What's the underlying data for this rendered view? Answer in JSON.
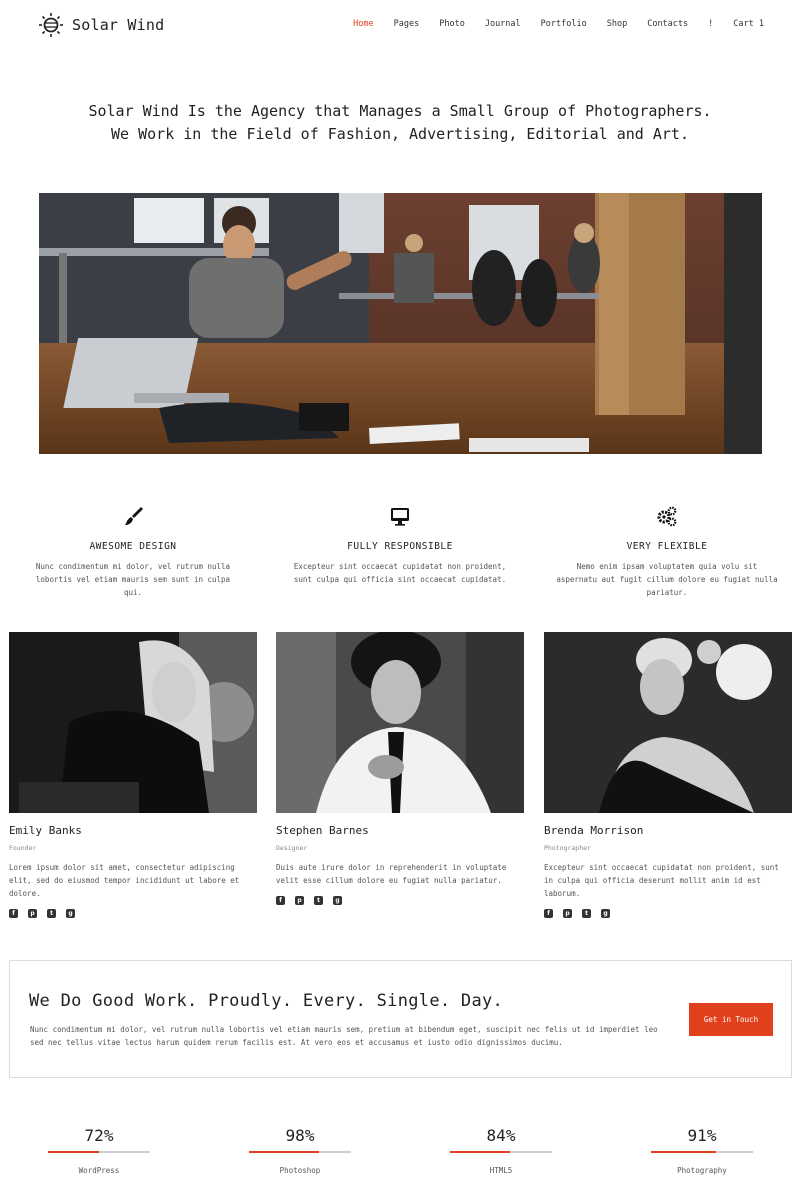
{
  "header": {
    "logo_text": "Solar Wind",
    "nav": [
      {
        "label": "Home",
        "active": true
      },
      {
        "label": "Pages"
      },
      {
        "label": "Photo"
      },
      {
        "label": "Journal"
      },
      {
        "label": "Portfolio"
      },
      {
        "label": "Shop"
      },
      {
        "label": "Contacts"
      },
      {
        "label": "!"
      },
      {
        "label": "Cart 1"
      }
    ]
  },
  "hero": {
    "line1": "Solar Wind Is the Agency that Manages a Small Group of Photographers.",
    "line2": "We Work in the Field of Fashion, Advertising, Editorial and Art."
  },
  "features": [
    {
      "icon": "paintbrush-icon",
      "title": "AWESOME DESIGN",
      "desc": "Nunc condimentum mi dolor, vel rutrum nulla lobortis vel etiam mauris sem sunt in culpa qui."
    },
    {
      "icon": "monitor-icon",
      "title": "FULLY RESPONSIBLE",
      "desc": "Excepteur sint occaecat cupidatat non proident, sunt culpa qui officia sint occaecat cupidatat."
    },
    {
      "icon": "gears-icon",
      "title": "VERY FLEXIBLE",
      "desc": "Nemo enim ipsam voluptatem quia volu sit aspernatu aut fugit cillum dolore eu fugiat nulla pariatur."
    }
  ],
  "team": [
    {
      "name": "Emily Banks",
      "role": "Founder",
      "bio": "Lorem ipsum dolor sit amet, consectetur adipiscing elit, sed do eiusmod tempor incididunt ut labore et dolore."
    },
    {
      "name": "Stephen Barnes",
      "role": "Designer",
      "bio": "Duis aute irure dolor in reprehenderit in voluptate velit esse cillum dolore eu fugiat nulla pariatur."
    },
    {
      "name": "Brenda Morrison",
      "role": "Photographer",
      "bio": "Excepteur sint occaecat cupidatat non proident, sunt in culpa qui officia deserunt mollit anim id est laborum."
    }
  ],
  "social_icons": [
    "facebook-icon",
    "pinterest-icon",
    "twitter-icon",
    "google-plus-icon"
  ],
  "cta": {
    "title": "We Do Good Work. Proudly. Every. Single. Day.",
    "desc": "Nunc condimentum mi dolor, vel rutrum nulla lobortis vel etiam mauris sem, pretium at bibendum eget, suscipit nec felis ut id imperdiet leo sed nec tellus vitae lectus harum quidem rerum facilis est. At vero eos et accusamus et iusto odio dignissimos ducimu.",
    "button": "Get in Touch"
  },
  "stats": [
    {
      "value": "72%",
      "percent": 72,
      "label": "WordPress"
    },
    {
      "value": "98%",
      "percent": 98,
      "label": "Photoshop"
    },
    {
      "value": "84%",
      "percent": 84,
      "label": "HTML5"
    },
    {
      "value": "91%",
      "percent": 91,
      "label": "Photography"
    }
  ],
  "colors": {
    "accent": "#e0401c",
    "text": "#222222",
    "muted": "#555555"
  }
}
